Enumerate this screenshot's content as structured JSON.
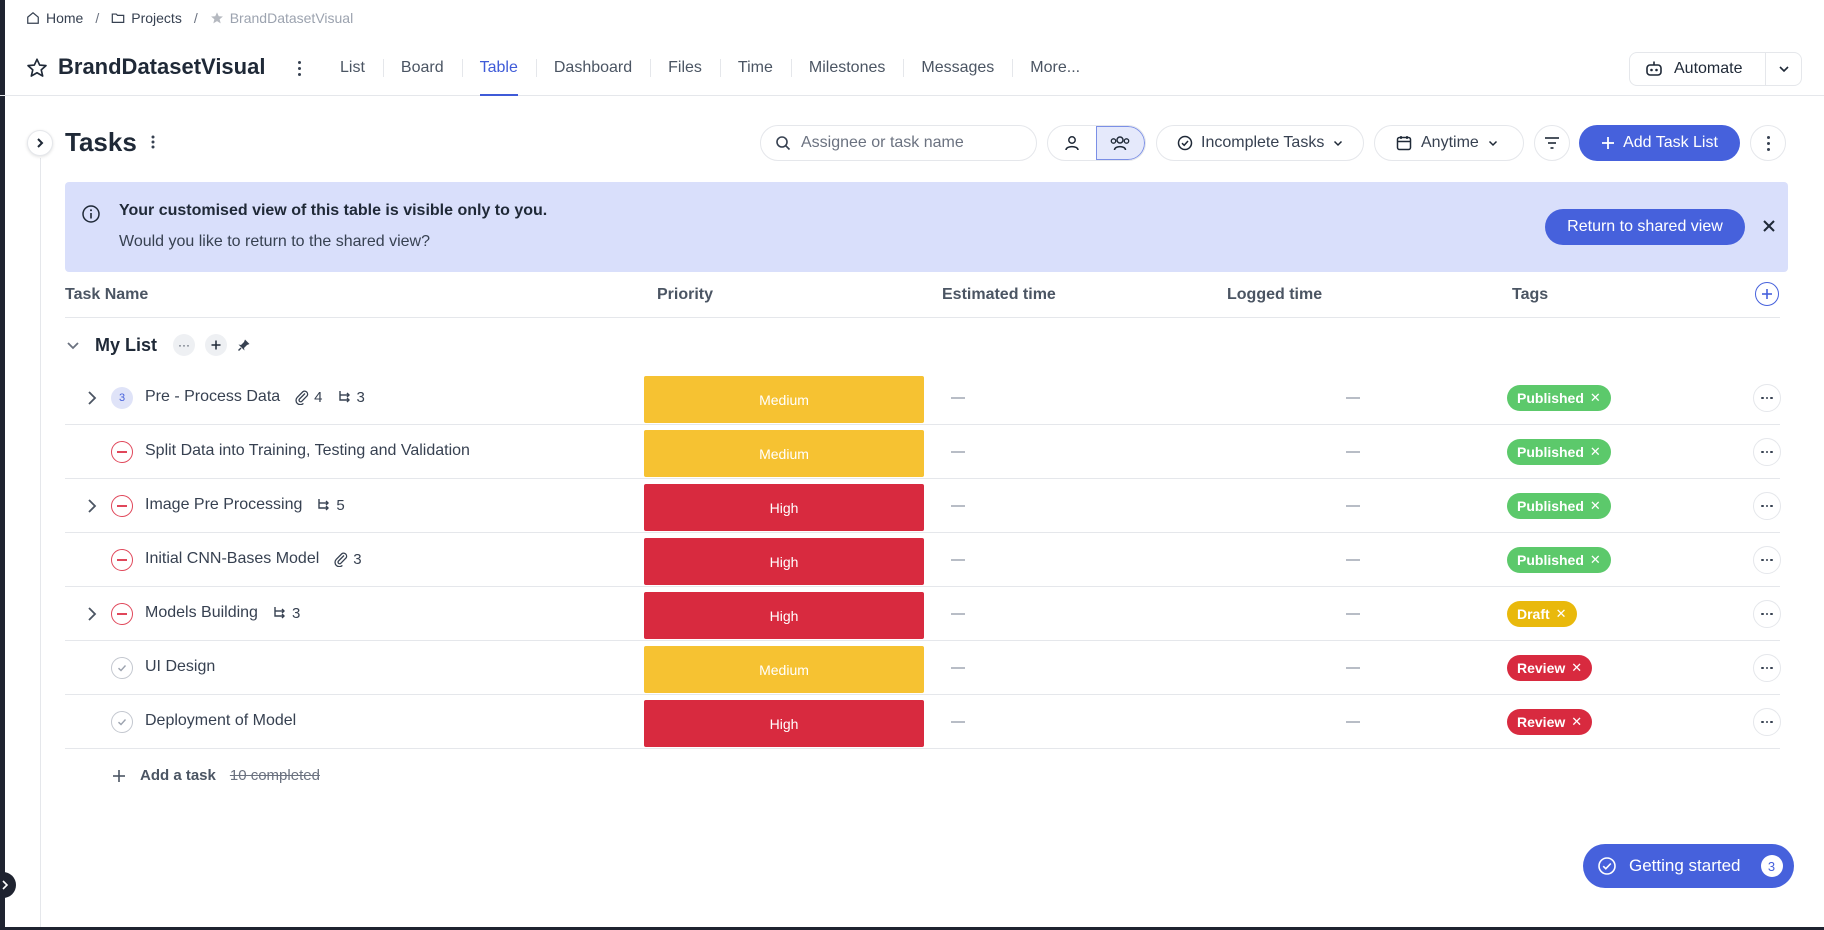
{
  "breadcrumb": {
    "home": "Home",
    "projects": "Projects",
    "current": "BrandDatasetVisual"
  },
  "project": {
    "title": "BrandDatasetVisual"
  },
  "tabs": [
    {
      "label": "List"
    },
    {
      "label": "Board"
    },
    {
      "label": "Table",
      "active": true
    },
    {
      "label": "Dashboard"
    },
    {
      "label": "Files"
    },
    {
      "label": "Time"
    },
    {
      "label": "Milestones"
    },
    {
      "label": "Messages"
    },
    {
      "label": "More..."
    }
  ],
  "automate": {
    "label": "Automate"
  },
  "toolbar": {
    "title": "Tasks",
    "search_placeholder": "Assignee or task name",
    "filter_status": "Incomplete Tasks",
    "filter_date": "Anytime",
    "add_list_label": "Add Task List"
  },
  "banner": {
    "title": "Your customised view of this table is visible only to you.",
    "subtitle": "Would you like to return to the shared view?",
    "button": "Return to shared view"
  },
  "columns": {
    "task_name": "Task Name",
    "priority": "Priority",
    "estimated": "Estimated time",
    "logged": "Logged time",
    "tags": "Tags"
  },
  "group": {
    "name": "My List"
  },
  "rows": [
    {
      "name": "Pre - Process Data",
      "status": "count",
      "status_text": "3",
      "expandable": true,
      "attachments": "4",
      "subtasks": "3",
      "priority": "Medium",
      "tag": "Published"
    },
    {
      "name": "Split Data into Training, Testing and Validation",
      "status": "blocked",
      "status_text": "",
      "expandable": false,
      "attachments": "",
      "subtasks": "",
      "priority": "Medium",
      "tag": "Published"
    },
    {
      "name": "Image Pre Processing",
      "status": "blocked",
      "status_text": "",
      "expandable": true,
      "attachments": "",
      "subtasks": "5",
      "priority": "High",
      "tag": "Published"
    },
    {
      "name": "Initial CNN-Bases Model",
      "status": "blocked",
      "status_text": "",
      "expandable": false,
      "attachments": "3",
      "subtasks": "",
      "priority": "High",
      "tag": "Published"
    },
    {
      "name": "Models Building",
      "status": "blocked",
      "status_text": "",
      "expandable": true,
      "attachments": "",
      "subtasks": "3",
      "priority": "High",
      "tag": "Draft"
    },
    {
      "name": "UI Design",
      "status": "todo",
      "status_text": "",
      "expandable": false,
      "attachments": "",
      "subtasks": "",
      "priority": "Medium",
      "tag": "Review"
    },
    {
      "name": "Deployment of Model",
      "status": "todo",
      "status_text": "",
      "expandable": false,
      "attachments": "",
      "subtasks": "",
      "priority": "High",
      "tag": "Review"
    }
  ],
  "add_task": {
    "label": "Add a task",
    "completed": "10 completed"
  },
  "getting_started": {
    "label": "Getting started",
    "count": "3"
  },
  "colors": {
    "accent": "#4661dc",
    "medium": "#f6c232",
    "high": "#d82a3f",
    "published": "#5cc96b",
    "draft": "#e9b90c",
    "review": "#d82a3f",
    "banner": "#d9dffb"
  }
}
